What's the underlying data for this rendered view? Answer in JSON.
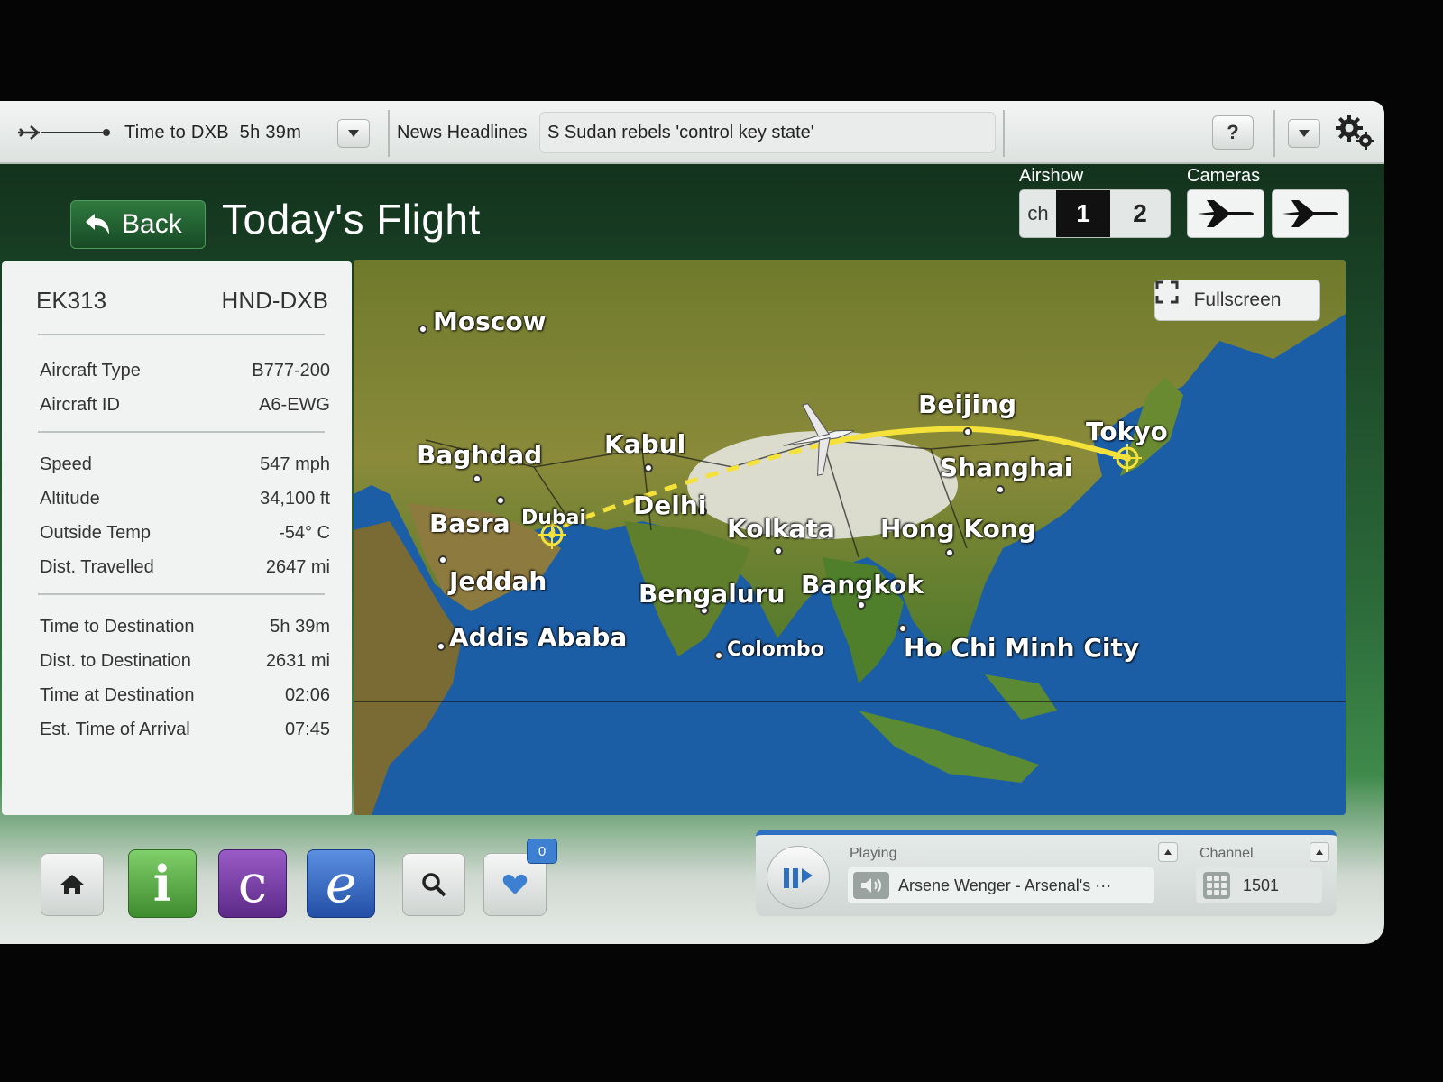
{
  "topbar": {
    "time_to_label": "Time to DXB",
    "time_to_value": "5h 39m",
    "news_label": "News Headlines",
    "news_headline": "S Sudan rebels 'control key state'",
    "help_label": "?"
  },
  "header": {
    "back_label": "Back",
    "title": "Today's Flight",
    "airshow_label": "Airshow",
    "ch_label": "ch",
    "channel_1": "1",
    "channel_2": "2",
    "cameras_label": "Cameras"
  },
  "flight": {
    "number": "EK313",
    "route": "HND-DXB",
    "aircraft_type_label": "Aircraft Type",
    "aircraft_type": "B777-200",
    "aircraft_id_label": "Aircraft ID",
    "aircraft_id": "A6-EWG",
    "speed_label": "Speed",
    "speed": "547 mph",
    "altitude_label": "Altitude",
    "altitude": "34,100 ft",
    "outside_temp_label": "Outside Temp",
    "outside_temp": "-54° C",
    "dist_travelled_label": "Dist. Travelled",
    "dist_travelled": "2647 mi",
    "time_to_dest_label": "Time to Destination",
    "time_to_dest": "5h 39m",
    "dist_to_dest_label": "Dist. to Destination",
    "dist_to_dest": "2631 mi",
    "time_at_dest_label": "Time at Destination",
    "time_at_dest": "02:06",
    "eta_label": "Est. Time of Arrival",
    "eta": "07:45"
  },
  "map": {
    "fullscreen_label": "Fullscreen",
    "cities": {
      "moscow": "Moscow",
      "beijing": "Beijing",
      "tokyo": "Tokyo",
      "baghdad": "Baghdad",
      "kabul": "Kabul",
      "shanghai": "Shanghai",
      "basra": "Basra",
      "dubai": "Dubai",
      "delhi": "Delhi",
      "kolkata": "Kolkata",
      "hong_kong": "Hong Kong",
      "jeddah": "Jeddah",
      "bengaluru": "Bengaluru",
      "bangkok": "Bangkok",
      "addis_ababa": "Addis Ababa",
      "colombo": "Colombo",
      "ho_chi_minh": "Ho Chi Minh City"
    }
  },
  "player": {
    "playing_label": "Playing",
    "track": "Arsene Wenger - Arsenal's ···",
    "channel_label": "Channel",
    "channel_number": "1501"
  },
  "favourites": {
    "count": "0"
  },
  "icons": {
    "home": "home-icon",
    "info": "i",
    "communicate": "c",
    "entertainment": "e",
    "search": "search-icon",
    "favourites": "heart-icon"
  },
  "colors": {
    "route_flown": "#f4e23a",
    "route_remaining": "#f4e23a",
    "player_accent": "#2d6fc0",
    "info_icon": "#4fa83b",
    "communicate_icon": "#7b3fae",
    "entertainment_icon": "#3566c4"
  }
}
